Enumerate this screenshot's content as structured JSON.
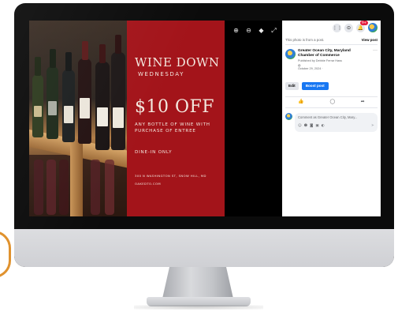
{
  "photo": {
    "ad": {
      "title_line1": "WINE DOWN",
      "title_line2": "WEDNESDAY",
      "offer": "$10 OFF",
      "offer_details": "ANY BOTTLE OF WINE WITH PURCHASE OF ENTREE",
      "dine_in": "DINE-IN ONLY",
      "address": "300 N WASHINGTON ST, SNOW HILL, MD",
      "website": "OAKEDTO.COM"
    },
    "tools": {
      "zoom_in": "⊕",
      "zoom_out": "⊖",
      "tag": "◆",
      "fullscreen": "⤢"
    }
  },
  "topbar": {
    "menu_icon": "⋮⋮",
    "messenger_icon": "⊙",
    "bell_icon": "🔔",
    "notification_count": "9+"
  },
  "post": {
    "from_post_text": "This photo is from a post.",
    "view_post_label": "View post",
    "page_name": "Greater Ocean City, Maryland Chamber of Commerce",
    "published_by": "Published by Debbie Ferrar Hass",
    "date": "October 29, 2024 ·",
    "edit_label": "Edit",
    "boost_label": "Boost post"
  },
  "comment": {
    "placeholder": "Comment as Greater Ocean City, Mary..."
  }
}
